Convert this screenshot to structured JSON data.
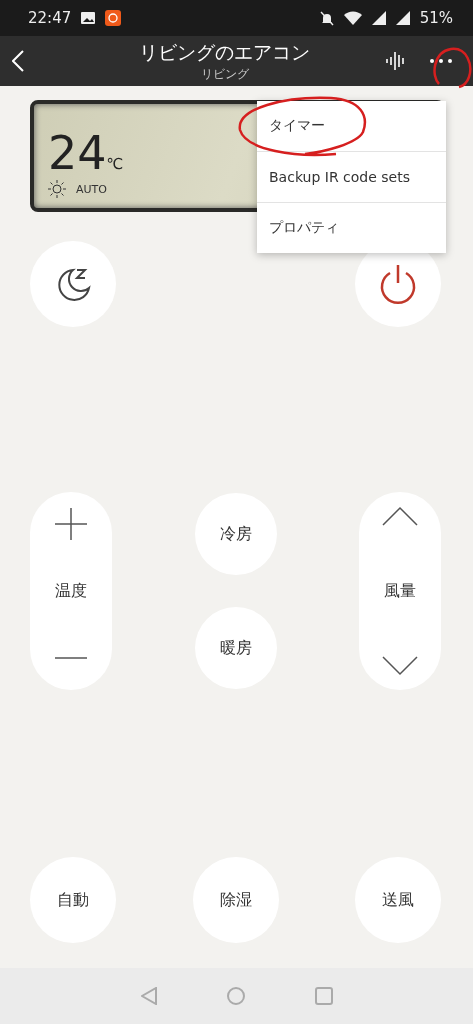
{
  "status_bar": {
    "time": "22:47",
    "battery": "51%"
  },
  "header": {
    "title": "リビングのエアコン",
    "subtitle": "リビング"
  },
  "display": {
    "temperature": "24",
    "unit": "℃",
    "mode": "AUTO"
  },
  "menu": {
    "items": [
      {
        "label": "タイマー",
        "circled": true
      },
      {
        "label": "Backup IR code sets",
        "circled": false
      },
      {
        "label": "プロパティ",
        "circled": false
      }
    ]
  },
  "adjusters": [
    {
      "kind": "plus-minus",
      "label": "温度"
    },
    {
      "kind": "up-down",
      "label": "風量"
    }
  ],
  "center_modes": [
    {
      "label": "冷房"
    },
    {
      "label": "暖房"
    }
  ],
  "bottom_modes": [
    {
      "label": "自動"
    },
    {
      "label": "除湿"
    },
    {
      "label": "送風"
    }
  ]
}
